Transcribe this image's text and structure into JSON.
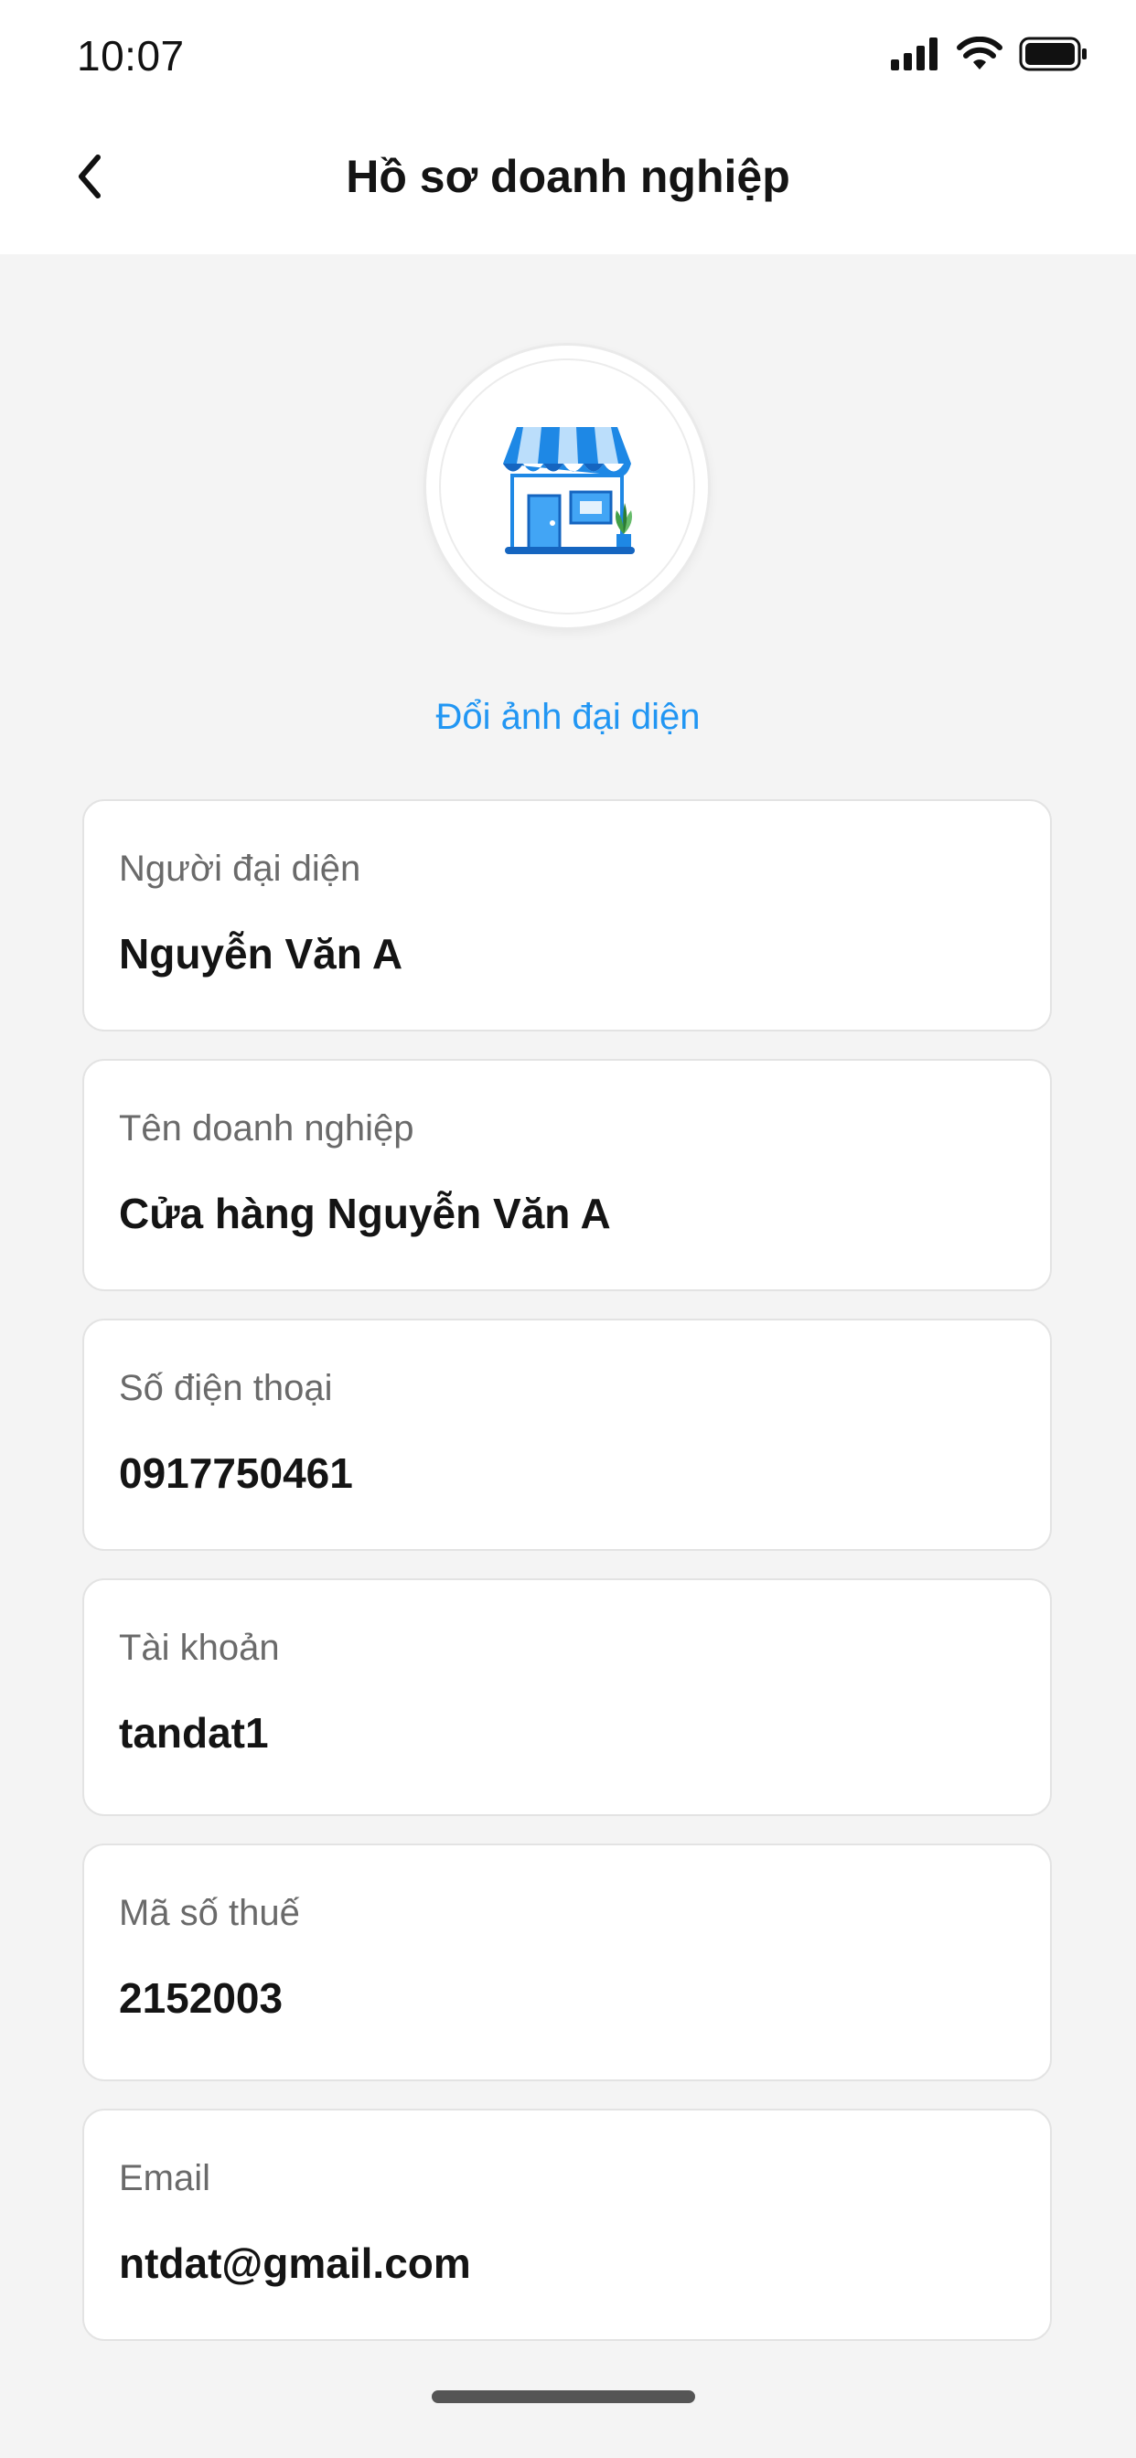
{
  "status_bar": {
    "time": "10:07"
  },
  "header": {
    "title": "Hồ sơ doanh nghiệp"
  },
  "avatar": {
    "icon": "store-icon",
    "change_label": "Đổi ảnh đại diện"
  },
  "fields": [
    {
      "label": "Người đại diện",
      "value": "Nguyễn Văn A"
    },
    {
      "label": "Tên doanh nghiệp",
      "value": "Cửa hàng Nguyễn Văn A"
    },
    {
      "label": "Số điện thoại",
      "value": "0917750461"
    },
    {
      "label": "Tài khoản",
      "value": "tandat1"
    },
    {
      "label": "Mã số thuế",
      "value": "2152003"
    },
    {
      "label": "Email",
      "value": "ntdat@gmail.com"
    }
  ],
  "colors": {
    "accent": "#2196f3",
    "background": "#f4f4f4",
    "card": "#ffffff"
  }
}
